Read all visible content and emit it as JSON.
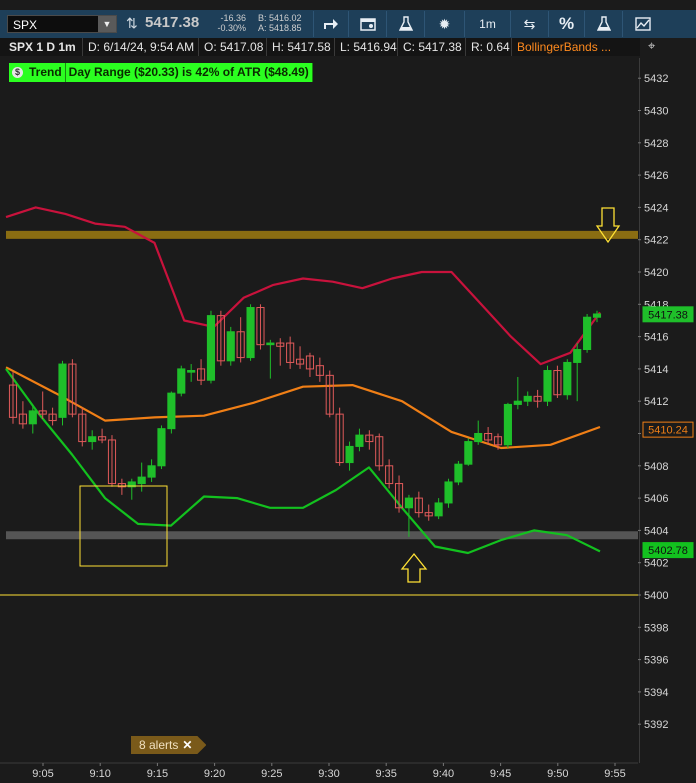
{
  "toolbar": {
    "symbol": "SPX",
    "caret": "▼",
    "last_price": "5417.38",
    "net_change": "-16.36",
    "net_change_pct": "-0.30%",
    "bid": "B: 5416.02",
    "ask": "A: 5418.85",
    "timeframe": "1m",
    "percent_label": "%",
    "icons": [
      "share-icon",
      "calendar-icon",
      "flask-icon",
      "gear-icon",
      "drawing-icon",
      "percent-icon",
      "flask-icon",
      "studies-icon"
    ]
  },
  "header": {
    "title": "SPX 1 D 1m",
    "date": "D: 6/14/24, 9:54 AM",
    "open": "O: 5417.08",
    "high": "H: 5417.58",
    "low": "L: 5416.94",
    "close": "C: 5417.38",
    "range": "R: 0.64",
    "study": "BollingerBands ..."
  },
  "trend_label": {
    "name": "Trend",
    "text": "Day Range ($20.33) is 42% of ATR ($48.49)",
    "color": "#2bff20"
  },
  "alerts": {
    "label": "8 alerts",
    "close": "✕"
  },
  "colors": {
    "up": "#1fbf2a",
    "down": "#e05a5a",
    "upper_band": "#c8123c",
    "mid_band": "#f07f16",
    "lower_band": "#13c11f",
    "resistance": "#8a6d12",
    "support": "#555555",
    "ref_line": "#ffe135"
  },
  "chart_data": {
    "type": "candlestick",
    "y_axis": {
      "ylim": [
        5391,
        5435
      ],
      "ticks": [
        5392,
        5394,
        5396,
        5398,
        5400,
        5402,
        5404,
        5406,
        5408,
        5410,
        5412,
        5414,
        5416,
        5418,
        5420,
        5422,
        5424,
        5426,
        5428,
        5430,
        5432
      ]
    },
    "x_axis": {
      "labels": [
        "9:05",
        "9:10",
        "9:15",
        "9:20",
        "9:25",
        "9:30",
        "9:35",
        "9:40",
        "9:45",
        "9:50",
        "9:55"
      ]
    },
    "candles": [
      {
        "o": 5413.0,
        "h": 5413.8,
        "l": 5410.6,
        "c": 5411.0
      },
      {
        "o": 5411.2,
        "h": 5412.0,
        "l": 5410.3,
        "c": 5410.6
      },
      {
        "o": 5410.6,
        "h": 5411.8,
        "l": 5410.0,
        "c": 5411.4
      },
      {
        "o": 5411.4,
        "h": 5412.6,
        "l": 5410.9,
        "c": 5411.2
      },
      {
        "o": 5411.2,
        "h": 5411.6,
        "l": 5410.5,
        "c": 5410.8
      },
      {
        "o": 5411.0,
        "h": 5414.5,
        "l": 5410.5,
        "c": 5414.3
      },
      {
        "o": 5414.3,
        "h": 5414.6,
        "l": 5411.0,
        "c": 5411.2
      },
      {
        "o": 5411.2,
        "h": 5411.6,
        "l": 5409.2,
        "c": 5409.5
      },
      {
        "o": 5409.5,
        "h": 5410.2,
        "l": 5409.0,
        "c": 5409.8
      },
      {
        "o": 5409.8,
        "h": 5410.3,
        "l": 5409.4,
        "c": 5409.6
      },
      {
        "o": 5409.6,
        "h": 5409.9,
        "l": 5406.7,
        "c": 5406.9
      },
      {
        "o": 5406.9,
        "h": 5407.2,
        "l": 5406.2,
        "c": 5406.7
      },
      {
        "o": 5406.7,
        "h": 5407.2,
        "l": 5405.9,
        "c": 5407.0
      },
      {
        "o": 5406.9,
        "h": 5408.2,
        "l": 5406.4,
        "c": 5407.3
      },
      {
        "o": 5407.3,
        "h": 5408.4,
        "l": 5407.0,
        "c": 5408.0
      },
      {
        "o": 5408.0,
        "h": 5410.5,
        "l": 5407.8,
        "c": 5410.3
      },
      {
        "o": 5410.3,
        "h": 5412.6,
        "l": 5410.0,
        "c": 5412.5
      },
      {
        "o": 5412.5,
        "h": 5414.2,
        "l": 5412.3,
        "c": 5414.0
      },
      {
        "o": 5413.8,
        "h": 5414.3,
        "l": 5413.2,
        "c": 5413.9
      },
      {
        "o": 5414.0,
        "h": 5414.6,
        "l": 5413.0,
        "c": 5413.3
      },
      {
        "o": 5413.3,
        "h": 5417.6,
        "l": 5413.1,
        "c": 5417.3
      },
      {
        "o": 5417.3,
        "h": 5417.6,
        "l": 5414.2,
        "c": 5414.5
      },
      {
        "o": 5414.5,
        "h": 5416.6,
        "l": 5414.2,
        "c": 5416.3
      },
      {
        "o": 5416.3,
        "h": 5417.2,
        "l": 5414.4,
        "c": 5414.7
      },
      {
        "o": 5414.7,
        "h": 5418.0,
        "l": 5414.5,
        "c": 5417.8
      },
      {
        "o": 5417.8,
        "h": 5418.0,
        "l": 5415.2,
        "c": 5415.5
      },
      {
        "o": 5415.5,
        "h": 5415.8,
        "l": 5413.4,
        "c": 5415.6
      },
      {
        "o": 5415.6,
        "h": 5415.9,
        "l": 5414.2,
        "c": 5415.4
      },
      {
        "o": 5415.6,
        "h": 5416.0,
        "l": 5414.0,
        "c": 5414.4
      },
      {
        "o": 5414.6,
        "h": 5415.4,
        "l": 5414.0,
        "c": 5414.3
      },
      {
        "o": 5414.8,
        "h": 5415.0,
        "l": 5413.5,
        "c": 5414.0
      },
      {
        "o": 5414.2,
        "h": 5414.7,
        "l": 5413.2,
        "c": 5413.6
      },
      {
        "o": 5413.6,
        "h": 5413.9,
        "l": 5411.0,
        "c": 5411.2
      },
      {
        "o": 5411.2,
        "h": 5411.6,
        "l": 5408.0,
        "c": 5408.2
      },
      {
        "o": 5408.2,
        "h": 5409.5,
        "l": 5407.7,
        "c": 5409.2
      },
      {
        "o": 5409.2,
        "h": 5410.3,
        "l": 5408.9,
        "c": 5409.9
      },
      {
        "o": 5409.9,
        "h": 5410.2,
        "l": 5409.0,
        "c": 5409.5
      },
      {
        "o": 5409.8,
        "h": 5410.0,
        "l": 5407.7,
        "c": 5408.0
      },
      {
        "o": 5408.0,
        "h": 5408.4,
        "l": 5406.6,
        "c": 5406.9
      },
      {
        "o": 5406.9,
        "h": 5407.4,
        "l": 5405.1,
        "c": 5405.4
      },
      {
        "o": 5405.4,
        "h": 5406.2,
        "l": 5403.6,
        "c": 5406.0
      },
      {
        "o": 5406.0,
        "h": 5406.4,
        "l": 5404.8,
        "c": 5405.1
      },
      {
        "o": 5405.1,
        "h": 5405.6,
        "l": 5404.6,
        "c": 5404.9
      },
      {
        "o": 5404.9,
        "h": 5406.0,
        "l": 5404.7,
        "c": 5405.7
      },
      {
        "o": 5405.7,
        "h": 5407.2,
        "l": 5405.4,
        "c": 5407.0
      },
      {
        "o": 5407.0,
        "h": 5408.3,
        "l": 5406.8,
        "c": 5408.1
      },
      {
        "o": 5408.1,
        "h": 5409.7,
        "l": 5408.0,
        "c": 5409.5
      },
      {
        "o": 5409.5,
        "h": 5410.8,
        "l": 5409.3,
        "c": 5410.0
      },
      {
        "o": 5410.0,
        "h": 5410.4,
        "l": 5409.3,
        "c": 5409.6
      },
      {
        "o": 5409.8,
        "h": 5410.0,
        "l": 5409.0,
        "c": 5409.3
      },
      {
        "o": 5409.3,
        "h": 5411.9,
        "l": 5409.1,
        "c": 5411.8
      },
      {
        "o": 5411.8,
        "h": 5413.5,
        "l": 5411.5,
        "c": 5412.0
      },
      {
        "o": 5412.0,
        "h": 5412.6,
        "l": 5411.7,
        "c": 5412.3
      },
      {
        "o": 5412.3,
        "h": 5412.7,
        "l": 5411.6,
        "c": 5412.0
      },
      {
        "o": 5412.0,
        "h": 5414.2,
        "l": 5411.7,
        "c": 5413.9
      },
      {
        "o": 5413.9,
        "h": 5414.2,
        "l": 5412.2,
        "c": 5412.4
      },
      {
        "o": 5412.4,
        "h": 5414.6,
        "l": 5412.1,
        "c": 5414.4
      },
      {
        "o": 5414.4,
        "h": 5415.6,
        "l": 5412.0,
        "c": 5415.2
      },
      {
        "o": 5415.2,
        "h": 5417.4,
        "l": 5415.0,
        "c": 5417.2
      },
      {
        "o": 5417.2,
        "h": 5417.6,
        "l": 5416.9,
        "c": 5417.4
      }
    ],
    "bands": {
      "upper": [
        5423.4,
        5424.0,
        5423.6,
        5423.0,
        5422.8,
        5421.8,
        5417.0,
        5416.6,
        5418.4,
        5419.2,
        5419.6,
        5419.4,
        5419.0,
        5419.6,
        5420.0,
        5420.0,
        5418.0,
        5416.0,
        5414.3,
        5415.0,
        5417.5
      ],
      "middle": [
        5414.1,
        5412.5,
        5410.8,
        5411.0,
        5411.1,
        5411.9,
        5412.9,
        5413.0,
        5412.0,
        5410.1,
        5409.1,
        5409.3,
        5410.4
      ],
      "lower": [
        5414.0,
        5411.2,
        5408.7,
        5406.0,
        5404.4,
        5404.3,
        5406.1,
        5406.0,
        5405.4,
        5405.4,
        5406.5,
        5407.9,
        5405.4,
        5403.0,
        5402.6,
        5403.4,
        5404.0,
        5403.7,
        5402.7
      ]
    },
    "hlines": {
      "resistance": 5422.3,
      "support": 5403.7,
      "reference": 5400.0
    },
    "price_labels": [
      {
        "value": 5417.38,
        "text": "5417.38",
        "color": "#1fbf2a"
      },
      {
        "value": 5410.24,
        "text": "5410.24",
        "color": "#f07f16"
      },
      {
        "value": 5402.78,
        "text": "5402.78",
        "color": "#13c11f"
      }
    ]
  }
}
